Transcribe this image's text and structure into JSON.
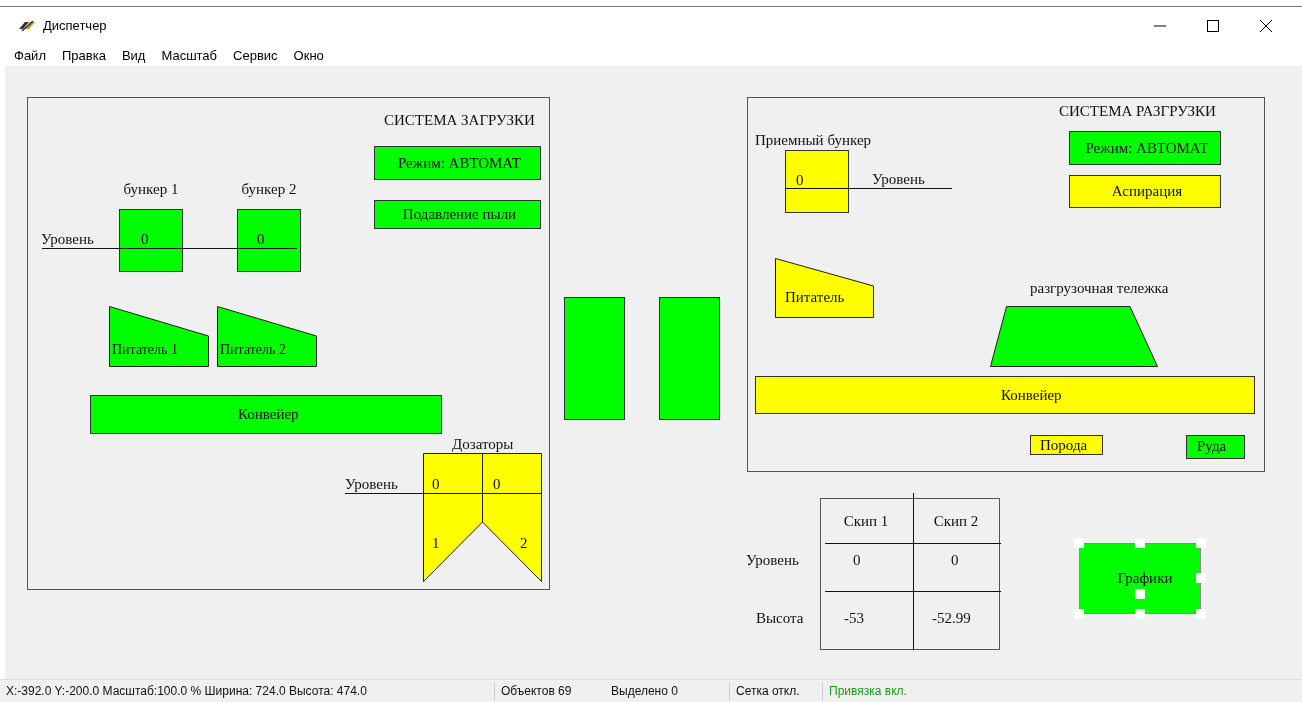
{
  "window": {
    "title": "Диспетчер"
  },
  "menu": [
    "Файл",
    "Правка",
    "Вид",
    "Масштаб",
    "Сервис",
    "Окно"
  ],
  "loading_system": {
    "title": "СИСТЕМА ЗАГРУЗКИ",
    "mode_button": {
      "label": "Режим: АВТОМАТ",
      "color": "#00ff00"
    },
    "dust_button": {
      "label": "Подавление пыли",
      "color": "#00ff00"
    },
    "level_label": "Уровень",
    "bunkers": [
      {
        "name": "бункер 1",
        "value": "0",
        "color": "#00ff00"
      },
      {
        "name": "бункер 2",
        "value": "0",
        "color": "#00ff00"
      }
    ],
    "feeders": [
      {
        "label": "Питатель 1",
        "color": "#00ff00"
      },
      {
        "label": "Питатель 2",
        "color": "#00ff00"
      }
    ],
    "conveyor": {
      "label": "Конвейер",
      "color": "#00ff00"
    },
    "dispensers": {
      "title": "Дозаторы",
      "level_label": "Уровень",
      "items": [
        {
          "value": "0",
          "number": "1",
          "color": "#ffff00"
        },
        {
          "value": "0",
          "number": "2",
          "color": "#ffff00"
        }
      ]
    }
  },
  "middle_blocks": [
    {
      "color": "#00ff00"
    },
    {
      "color": "#00ff00"
    }
  ],
  "unloading_system": {
    "title": "СИСТЕМА РАЗГРУЗКИ",
    "mode_button": {
      "label": "Режим: АВТОМАТ",
      "color": "#00ff00"
    },
    "aspiration_button": {
      "label": "Аспирация",
      "color": "#ffff00"
    },
    "receiving_bunker": {
      "name": "Приемный бункер",
      "value": "0",
      "level_label": "Уровень",
      "color": "#ffff00"
    },
    "feeder": {
      "label": "Питатель",
      "color": "#ffff00"
    },
    "trolley": {
      "label": "разгрузочная тележка",
      "color": "#00ff00"
    },
    "conveyor": {
      "label": "Конвейер",
      "color": "#ffff00"
    },
    "outputs": [
      {
        "label": "Порода",
        "color": "#ffff00"
      },
      {
        "label": "Руда",
        "color": "#00ff00"
      }
    ]
  },
  "skips": {
    "columns": [
      "Скип 1",
      "Скип 2"
    ],
    "rows": [
      {
        "label": "Уровень",
        "values": [
          "0",
          "0"
        ]
      },
      {
        "label": "Высота",
        "values": [
          "-53",
          "-52.99"
        ]
      }
    ]
  },
  "charts_button": {
    "label": "Графики",
    "color": "#00ff00",
    "selected": true
  },
  "status_bar": {
    "coordinates": "X:-392.0  Y:-200.0  Масштаб:100.0 % Ширина: 724.0 Высота: 474.0",
    "objects": "Объектов 69",
    "selected_count": "Выделено 0",
    "grid": "Сетка откл.",
    "snap": "Привязка вкл."
  }
}
